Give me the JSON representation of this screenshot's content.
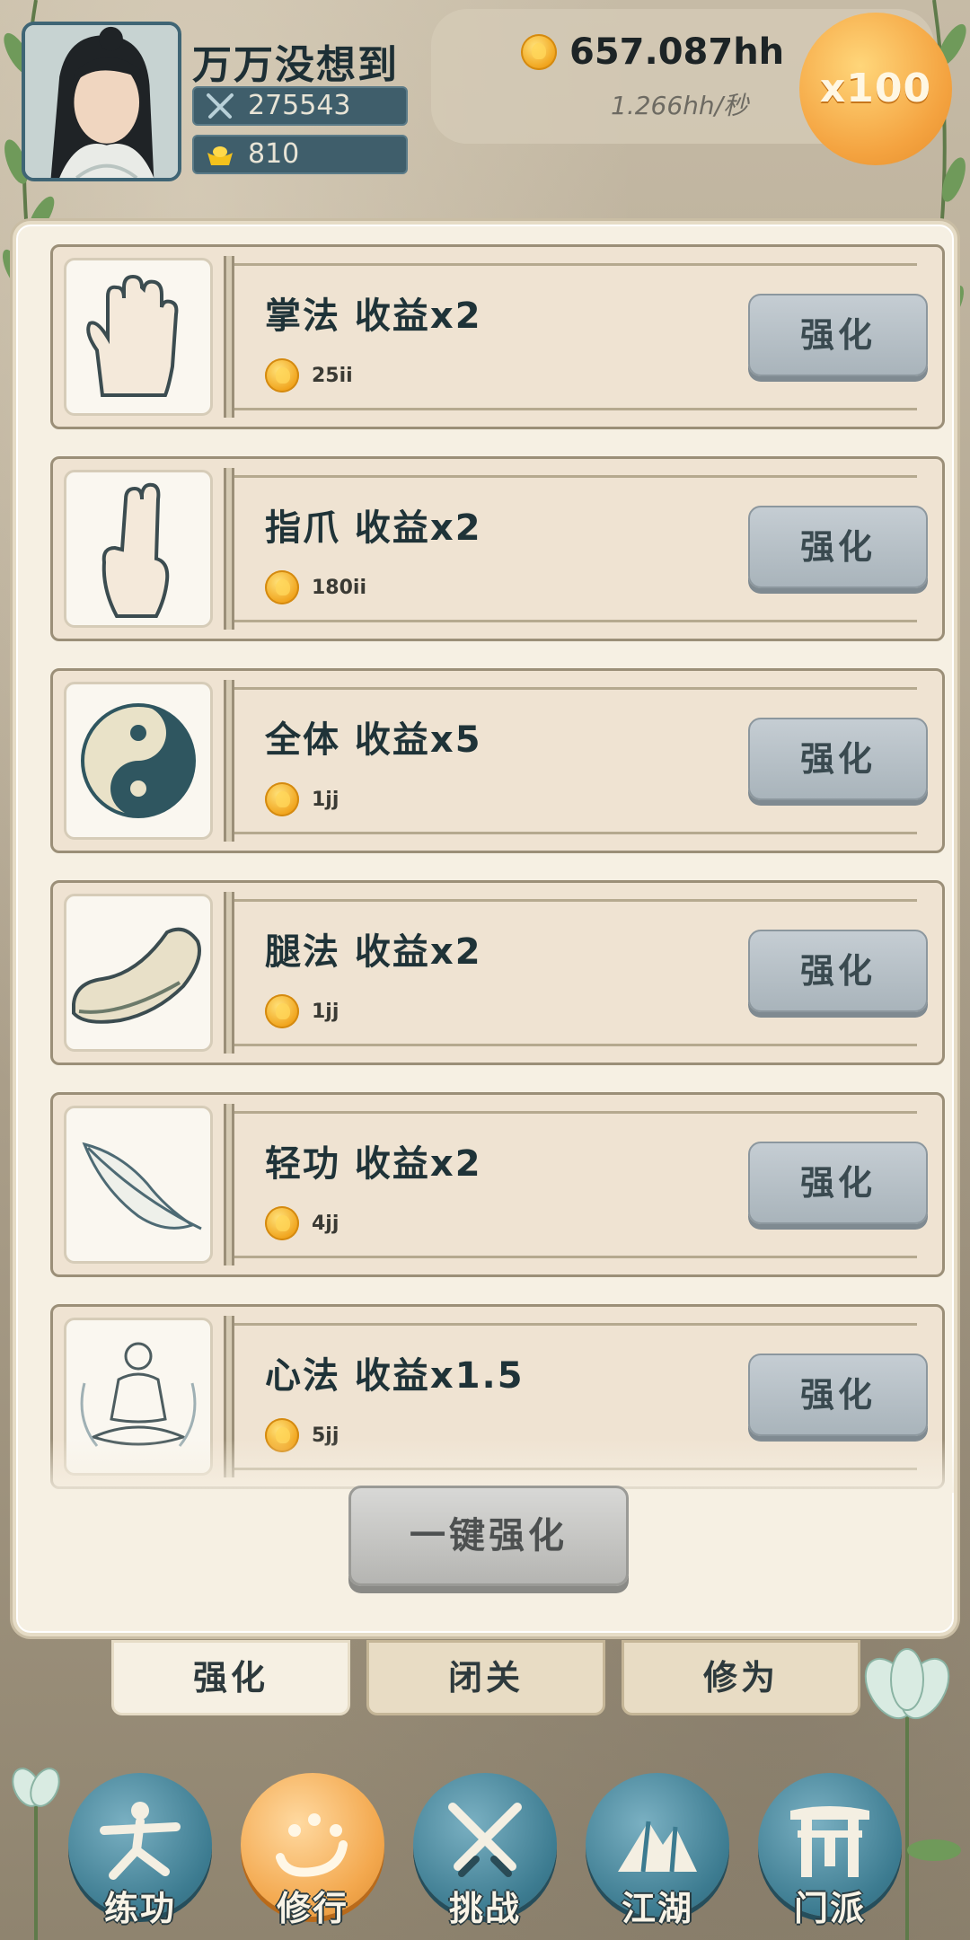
{
  "header": {
    "player_name": "万万没想到",
    "power": "275543",
    "gold": "810",
    "coins": "657.087hh",
    "rate": "1.266hh/秒",
    "multiplier": "x100"
  },
  "cards": [
    {
      "title": "掌法 收益x2",
      "cost": "25ii",
      "button": "强化",
      "icon": "palm-icon"
    },
    {
      "title": "指爪 收益x2",
      "cost": "180ii",
      "button": "强化",
      "icon": "two-finger-icon"
    },
    {
      "title": "全体 收益x5",
      "cost": "1jj",
      "button": "强化",
      "icon": "yin-yang-icon"
    },
    {
      "title": "腿法 收益x2",
      "cost": "1jj",
      "button": "强化",
      "icon": "shoe-icon"
    },
    {
      "title": "轻功 收益x2",
      "cost": "4jj",
      "button": "强化",
      "icon": "feather-icon"
    },
    {
      "title": "心法 收益x1.5",
      "cost": "5jj",
      "button": "强化",
      "icon": "meditation-icon"
    }
  ],
  "onekey_label": "一键强化",
  "tabs": [
    {
      "label": "强化",
      "active": true
    },
    {
      "label": "闭关",
      "active": false
    },
    {
      "label": "修为",
      "active": false
    }
  ],
  "nav": [
    {
      "label": "练功",
      "active": false,
      "icon": "martial-stance-icon"
    },
    {
      "label": "修行",
      "active": true,
      "icon": "heart-icon"
    },
    {
      "label": "挑战",
      "active": false,
      "icon": "crossed-swords-icon"
    },
    {
      "label": "江湖",
      "active": false,
      "icon": "mountain-icon"
    },
    {
      "label": "门派",
      "active": false,
      "icon": "gate-icon"
    }
  ],
  "colors": {
    "accent_orange": "#f3a84e",
    "nav_teal": "#3c7b90",
    "button_grey": "#a9b4bb"
  }
}
